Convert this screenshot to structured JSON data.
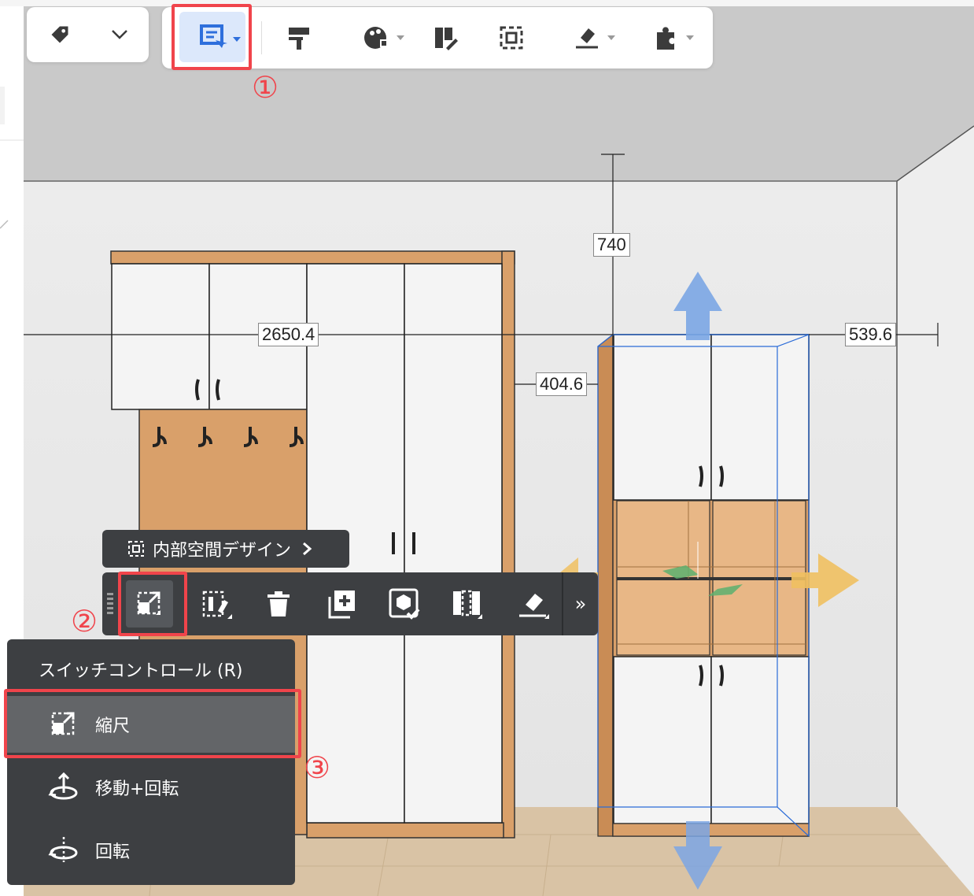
{
  "top_toolbar": {
    "left_group": {
      "tag_icon": "tag-icon",
      "chevron_icon": "chevron-down-icon"
    },
    "tools": [
      {
        "name": "display-mode",
        "icon": "selection-display-icon",
        "active": true
      },
      {
        "name": "paint",
        "icon": "paint-roller-icon"
      },
      {
        "name": "material",
        "icon": "material-palette-icon"
      },
      {
        "name": "door-edit",
        "icon": "door-edit-icon"
      },
      {
        "name": "select-frame",
        "icon": "select-frame-icon"
      },
      {
        "name": "level",
        "icon": "eraser-level-icon"
      },
      {
        "name": "plugin",
        "icon": "puzzle-icon"
      }
    ]
  },
  "annotations": {
    "step1": "①",
    "step2": "②",
    "step3": "③"
  },
  "dimensions": {
    "top": "740",
    "left_width": "2650.4",
    "right_gap": "539.6",
    "middle_gap": "404.6"
  },
  "interior_tip": {
    "label": "内部空間デザイン",
    "icon": "interior-frame-icon",
    "arrow": "chevron-right-icon"
  },
  "floating_toolbar": {
    "buttons": [
      {
        "name": "scale",
        "icon": "scale-icon"
      },
      {
        "name": "door-panel",
        "icon": "door-panel-icon"
      },
      {
        "name": "delete",
        "icon": "trash-icon"
      },
      {
        "name": "duplicate",
        "icon": "duplicate-icon"
      },
      {
        "name": "check-model",
        "icon": "check-model-icon"
      },
      {
        "name": "split",
        "icon": "split-panel-icon"
      },
      {
        "name": "level",
        "icon": "eraser-level-icon"
      }
    ],
    "more": "»"
  },
  "switch_menu": {
    "title": "スイッチコントロール (R)",
    "items": [
      {
        "label": "縮尺",
        "icon": "scale-icon",
        "selected": true
      },
      {
        "label": "移動+回転",
        "icon": "move-rotate-icon"
      },
      {
        "label": "回転",
        "icon": "rotate-icon"
      }
    ]
  },
  "colors": {
    "accent_red": "#f0444b",
    "active_blue": "#2e6fdc",
    "wood": "#d9a06a",
    "panel": "#3d3f42"
  }
}
